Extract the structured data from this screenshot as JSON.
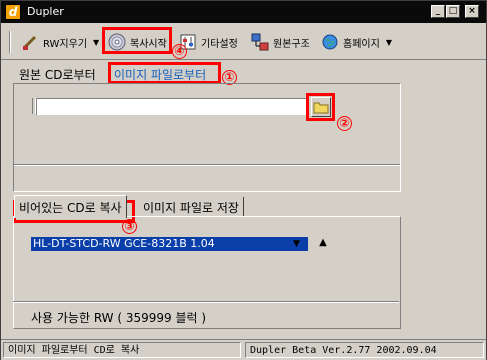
{
  "window": {
    "title": "Dupler",
    "app_icon_letter": "d",
    "controls": {
      "minimize": "_",
      "maximize": "□",
      "close": "×"
    }
  },
  "toolbar": {
    "items": [
      {
        "label": "RW지우기",
        "icon": "rw-erase-icon",
        "has_dropdown": true
      },
      {
        "label": "복사시작",
        "icon": "cd-disc-icon",
        "has_dropdown": false
      },
      {
        "label": "기타설정",
        "icon": "settings-icon",
        "has_dropdown": false
      },
      {
        "label": "원본구조",
        "icon": "structure-icon",
        "has_dropdown": false
      },
      {
        "label": "홈페이지",
        "icon": "globe-icon",
        "has_dropdown": true
      }
    ],
    "dropdown_glyph": "▼"
  },
  "source": {
    "label": "원본 CD로부터",
    "image_label": "이미지 파일로부터",
    "folder_icon": "folder-icon",
    "path_value": ""
  },
  "target_tabs": {
    "active": "비어있는 CD로 복사",
    "inactive": "이미지 파일로 저장"
  },
  "drive": {
    "selected": "HL-DT-STCD-RW GCE-8321B 1.04",
    "eject_glyph": "▲"
  },
  "rw_info": "사용 가능한 RW ( 359999 블럭 )",
  "annotations": {
    "n1": "①",
    "n2": "②",
    "n3": "③",
    "n4": "④"
  },
  "status": {
    "left": "이미지 파일로부터 CD로 복사",
    "right": "Dupler Beta Ver.2.77 2002.09.04"
  },
  "colors": {
    "title_bg": "#0a0a0a",
    "window_bg": "#d4d0c8",
    "accent_blue": "#1560bd",
    "annotation_red": "#ff0000",
    "selection_bg": "#0a3ea8"
  }
}
